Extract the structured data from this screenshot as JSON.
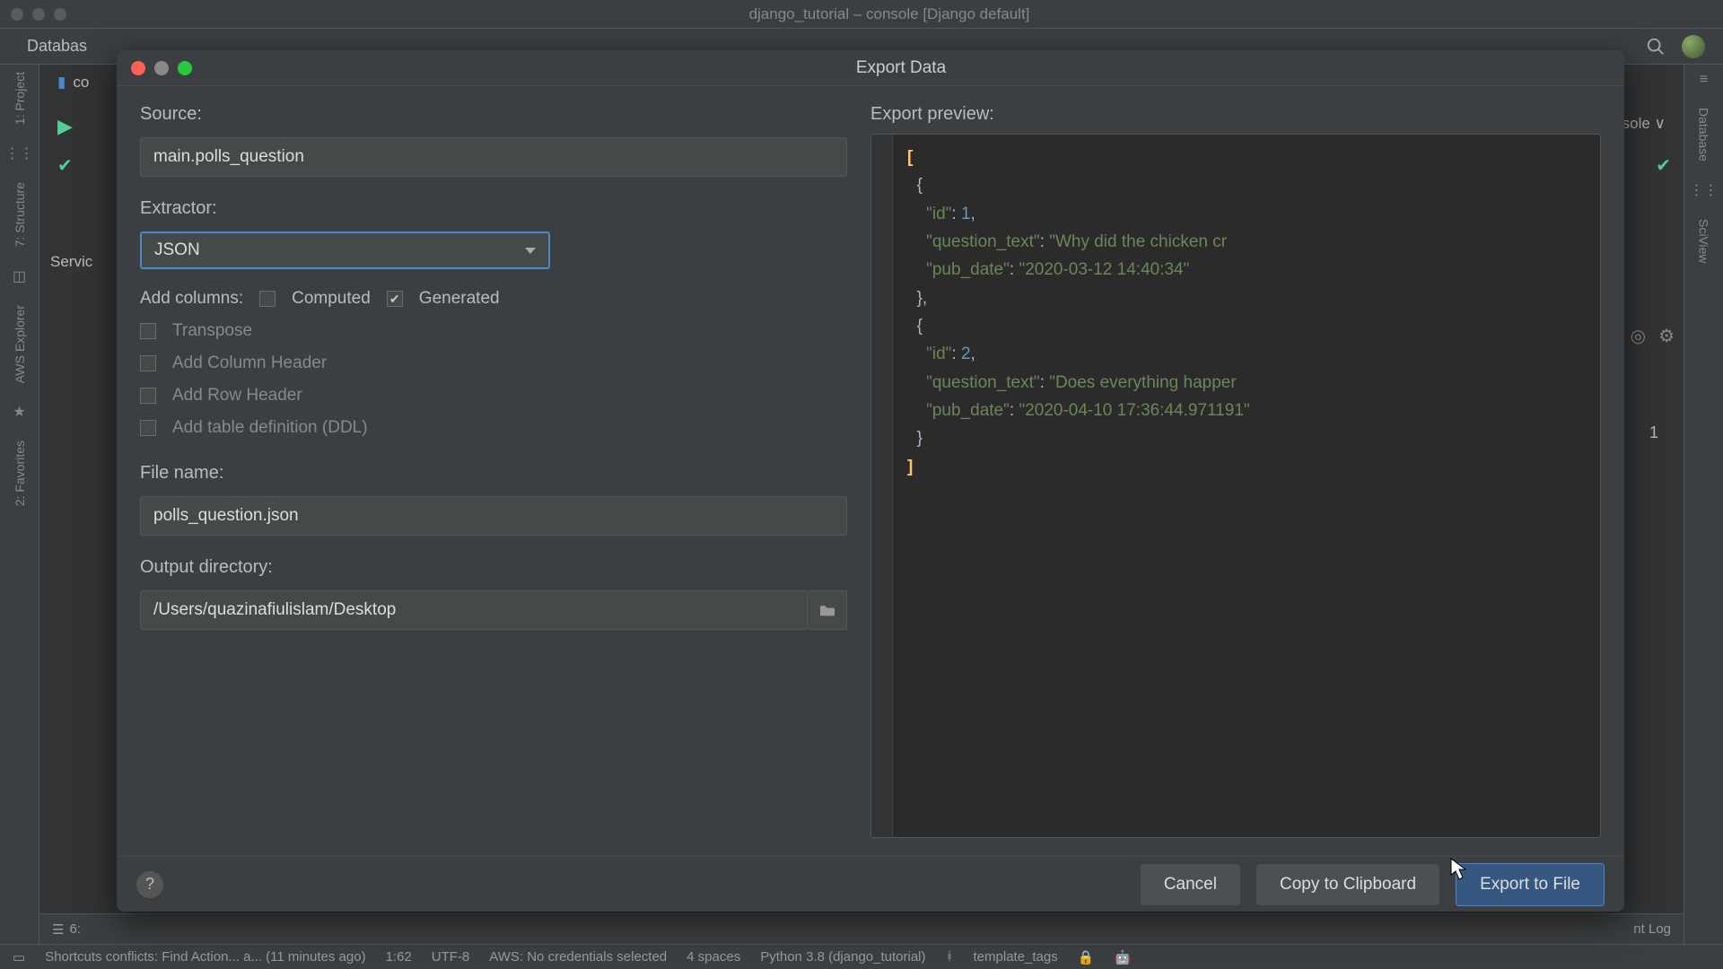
{
  "window_title": "django_tutorial – console [Django default]",
  "top_tab": "Databas",
  "right_top_text": "sole ∨",
  "search_icon_name": "search",
  "left_gutter": {
    "items": [
      "1: Project",
      "7: Structure",
      "AWS Explorer",
      "2: Favorites"
    ]
  },
  "right_gutter": {
    "items": [
      "Database",
      "SciView"
    ]
  },
  "services_label": "Servic",
  "right_num": "1",
  "editor_tab": "co",
  "modal": {
    "title": "Export Data",
    "source_label": "Source:",
    "source_value": "main.polls_question",
    "extractor_label": "Extractor:",
    "extractor_value": "JSON",
    "add_columns_label": "Add columns:",
    "computed_label": "Computed",
    "generated_label": "Generated",
    "generated_checked": true,
    "transpose_label": "Transpose",
    "add_col_header_label": "Add Column Header",
    "add_row_header_label": "Add Row Header",
    "add_ddl_label": "Add table definition (DDL)",
    "file_name_label": "File name:",
    "file_name_value": "polls_question.json",
    "output_dir_label": "Output directory:",
    "output_dir_value": "/Users/quazinafiulislam/Desktop",
    "preview_label": "Export preview:",
    "cancel": "Cancel",
    "copy": "Copy to Clipboard",
    "export": "Export to File"
  },
  "preview": {
    "r1_id": 1,
    "r1_q": "Why did the chicken cr",
    "r1_d": "2020-03-12 14:40:34",
    "r2_id": 2,
    "r2_q": "Does everything happer",
    "r2_d": "2020-04-10 17:36:44.971191"
  },
  "bottom_strip": {
    "left": "6:",
    "right": "nt Log"
  },
  "status": {
    "shortcuts": "Shortcuts conflicts: Find Action... a... (11 minutes ago)",
    "pos": "1:62",
    "enc": "UTF-8",
    "aws": "AWS: No credentials selected",
    "spaces": "4 spaces",
    "python": "Python 3.8 (django_tutorial)",
    "git": "template_tags"
  }
}
